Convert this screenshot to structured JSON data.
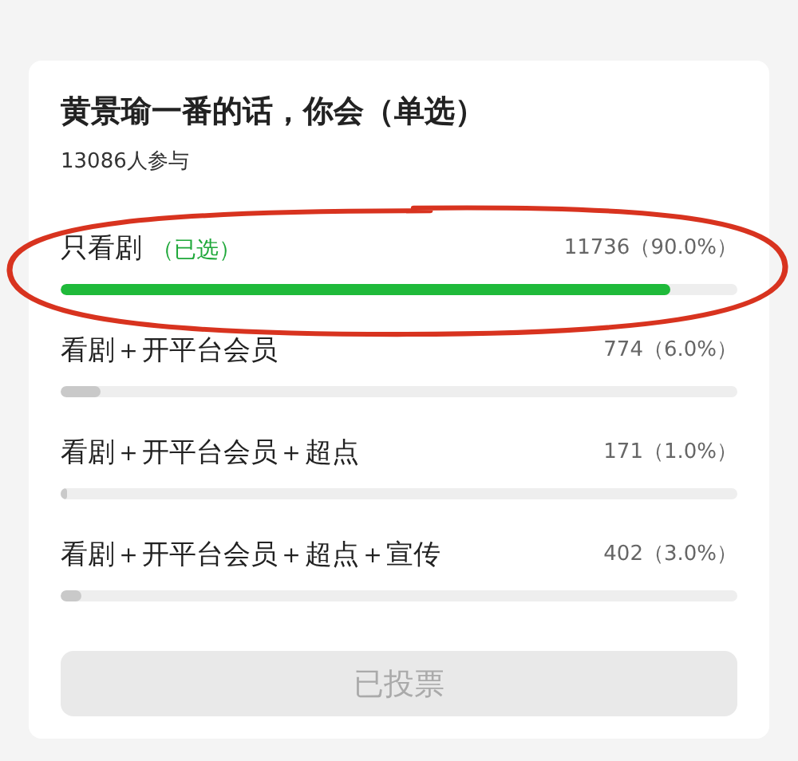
{
  "poll": {
    "title": "黄景瑜一番的话，你会（单选）",
    "participants": "13086人参与",
    "options": [
      {
        "label": "只看剧",
        "note": "（已选）",
        "count": "11736（90.0%）",
        "selected": true,
        "level": 0.9
      },
      {
        "label": "看剧＋开平台会员",
        "count": "774（6.0%）",
        "selected": false,
        "level": 0.06
      },
      {
        "label": "看剧＋开平台会员＋超点",
        "count": "171（1.0%）",
        "selected": false,
        "level": 0.01
      },
      {
        "label": "看剧＋开平台会员＋超点＋宣传",
        "count": "402（3.0%）",
        "selected": false,
        "level": 0.03
      }
    ],
    "button": {
      "label": "已投票",
      "disabled": true
    }
  }
}
